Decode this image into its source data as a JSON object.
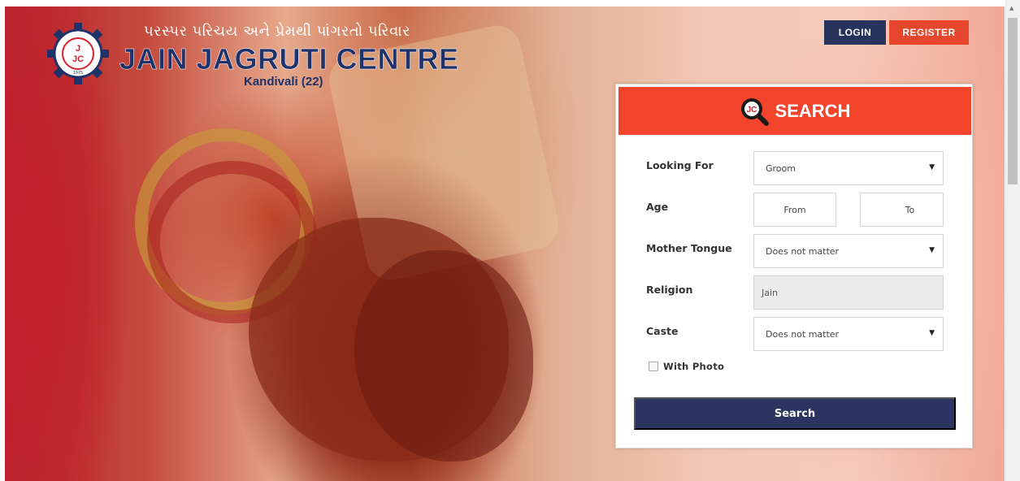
{
  "header": {
    "tagline": "પરસ્પર પરિચય અને પ્રેમથી પાંગરતો પરિવાર",
    "brand": "JAIN JAGRUTI CENTRE",
    "subbrand": "Kandivali (22)",
    "logo_text": "JJC",
    "logo_ring_text": "JAIN JAGRUTI CENTRE",
    "logo_year": "1975"
  },
  "nav": {
    "login_label": "LOGIN",
    "register_label": "REGISTER"
  },
  "search": {
    "title": "SEARCH",
    "looking_for": {
      "label": "Looking For",
      "value": "Groom"
    },
    "age": {
      "label": "Age",
      "from": "From",
      "to": "To"
    },
    "mother_tongue": {
      "label": "Mother Tongue",
      "value": "Does not matter"
    },
    "religion": {
      "label": "Religion",
      "value": "Jain"
    },
    "caste": {
      "label": "Caste",
      "value": "Does not matter"
    },
    "with_photo": {
      "label": "With Photo",
      "checked": false
    },
    "submit_label": "Search"
  },
  "colors": {
    "brand_navy": "#27335d",
    "accent_red": "#f1442a"
  },
  "icons": {
    "select_arrow": "▼",
    "scroll_up": "▲"
  }
}
